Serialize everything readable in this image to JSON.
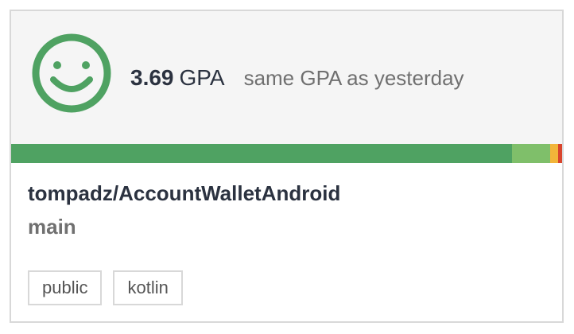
{
  "icon": "smiley-icon",
  "gpa": {
    "value": "3.69",
    "unit": "GPA",
    "change_text": "same GPA as yesterday"
  },
  "rating_bar": {
    "segments": [
      {
        "grade": "A",
        "fraction": 0.905,
        "color": "#4fa262"
      },
      {
        "grade": "B",
        "fraction": 0.069,
        "color": "#7fbf6a"
      },
      {
        "grade": "C",
        "fraction": 0.014,
        "color": "#f2b53a"
      },
      {
        "grade": "D",
        "fraction": 0.012,
        "color": "#d9452d"
      }
    ]
  },
  "repo": {
    "name": "tompadz/AccountWalletAndroid",
    "branch": "main"
  },
  "tags": [
    "public",
    "kotlin"
  ],
  "colors": {
    "smiley": "#4fa262",
    "title_text": "#2b3240",
    "muted_text": "#707070",
    "header_bg": "#f5f5f5",
    "border": "#d8d8d8"
  }
}
